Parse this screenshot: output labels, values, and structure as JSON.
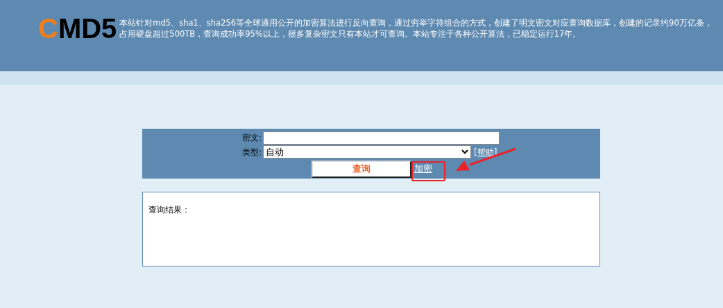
{
  "logo": {
    "first_letter": "C",
    "rest": "MD5"
  },
  "intro": [
    "本站针对md5、sha1、sha256等全球通用公开的加密算法进行反向查询，通过穷举字符组合的方式，创建了明文密文对应查询数据库，创建的记录约90万亿条，",
    "占用硬盘超过500TB，查询成功率95%以上，很多复杂密文只有本站才可查询。本站专注于各种公开算法，已稳定运行17年。"
  ],
  "form": {
    "ciphertext_label": "密文:",
    "type_label": "类型:",
    "type_value": "自动",
    "help_link": "[帮助]",
    "query_button": "查询",
    "encrypt_link": "加密"
  },
  "result": {
    "label": "查询结果："
  }
}
